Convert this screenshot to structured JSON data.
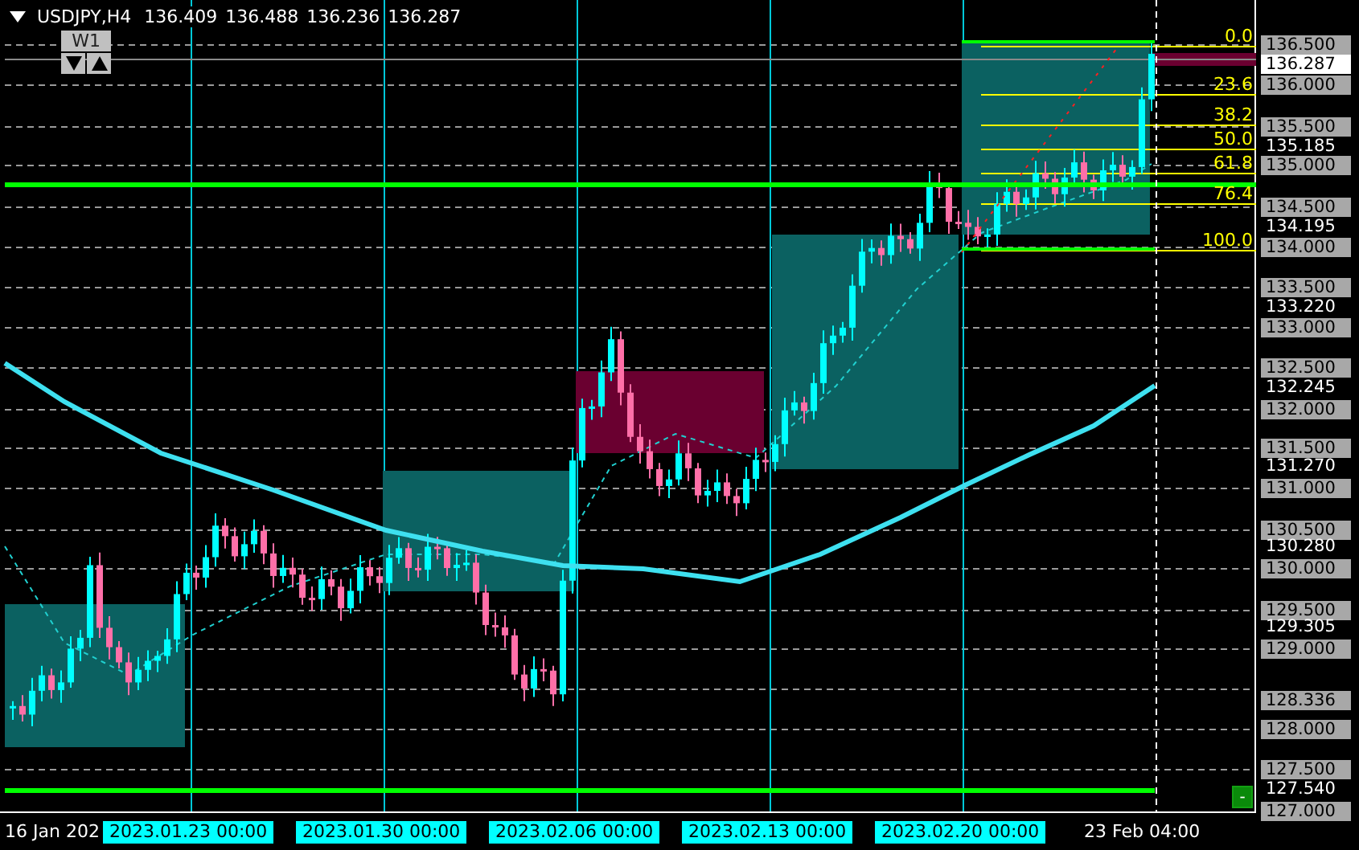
{
  "header": {
    "symbol": "USDJPY,H4",
    "prices": [
      "136.409",
      "136.488",
      "136.236",
      "136.287"
    ]
  },
  "timeframe_button": {
    "label": "W1"
  },
  "fibonacci_levels": [
    "0.0",
    "23.6",
    "38.2",
    "50.0",
    "61.8",
    "76.4",
    "100.0"
  ],
  "price_axis": [
    {
      "label": "136.500",
      "kind": "grid"
    },
    {
      "label": "136.287",
      "kind": "current"
    },
    {
      "label": "136.000",
      "kind": "grid"
    },
    {
      "label": "135.500",
      "kind": "grid"
    },
    {
      "label": "135.185",
      "kind": "level"
    },
    {
      "label": "135.000",
      "kind": "grid"
    },
    {
      "label": "134.500",
      "kind": "grid"
    },
    {
      "label": "134.195",
      "kind": "level"
    },
    {
      "label": "134.000",
      "kind": "grid"
    },
    {
      "label": "133.500",
      "kind": "grid"
    },
    {
      "label": "133.220",
      "kind": "level"
    },
    {
      "label": "133.000",
      "kind": "grid"
    },
    {
      "label": "132.500",
      "kind": "grid"
    },
    {
      "label": "132.245",
      "kind": "level"
    },
    {
      "label": "132.000",
      "kind": "grid"
    },
    {
      "label": "131.500",
      "kind": "grid"
    },
    {
      "label": "131.270",
      "kind": "level"
    },
    {
      "label": "131.000",
      "kind": "grid"
    },
    {
      "label": "130.500",
      "kind": "grid"
    },
    {
      "label": "130.280",
      "kind": "level"
    },
    {
      "label": "130.000",
      "kind": "grid"
    },
    {
      "label": "129.500",
      "kind": "grid"
    },
    {
      "label": "129.305",
      "kind": "level"
    },
    {
      "label": "129.000",
      "kind": "grid"
    },
    {
      "label": "128.336",
      "kind": "grid"
    },
    {
      "label": "128.000",
      "kind": "grid"
    },
    {
      "label": "127.500",
      "kind": "grid"
    },
    {
      "label": "127.540",
      "kind": "level"
    },
    {
      "label": "127.000",
      "kind": "grid"
    }
  ],
  "time_axis": [
    {
      "label": "16 Jan 202",
      "kind": "plain"
    },
    {
      "label": "2023.01.23 00:00",
      "kind": "marker"
    },
    {
      "label": "2023.01.30 00:00",
      "kind": "marker"
    },
    {
      "label": "2023.02.06 00:00",
      "kind": "marker"
    },
    {
      "label": "2023.02.13 00:00",
      "kind": "marker"
    },
    {
      "label": "2023.02.20 00:00",
      "kind": "marker"
    },
    {
      "label": "23 Feb 04:00",
      "kind": "plain"
    }
  ],
  "corner_button": {
    "label": "-"
  }
}
